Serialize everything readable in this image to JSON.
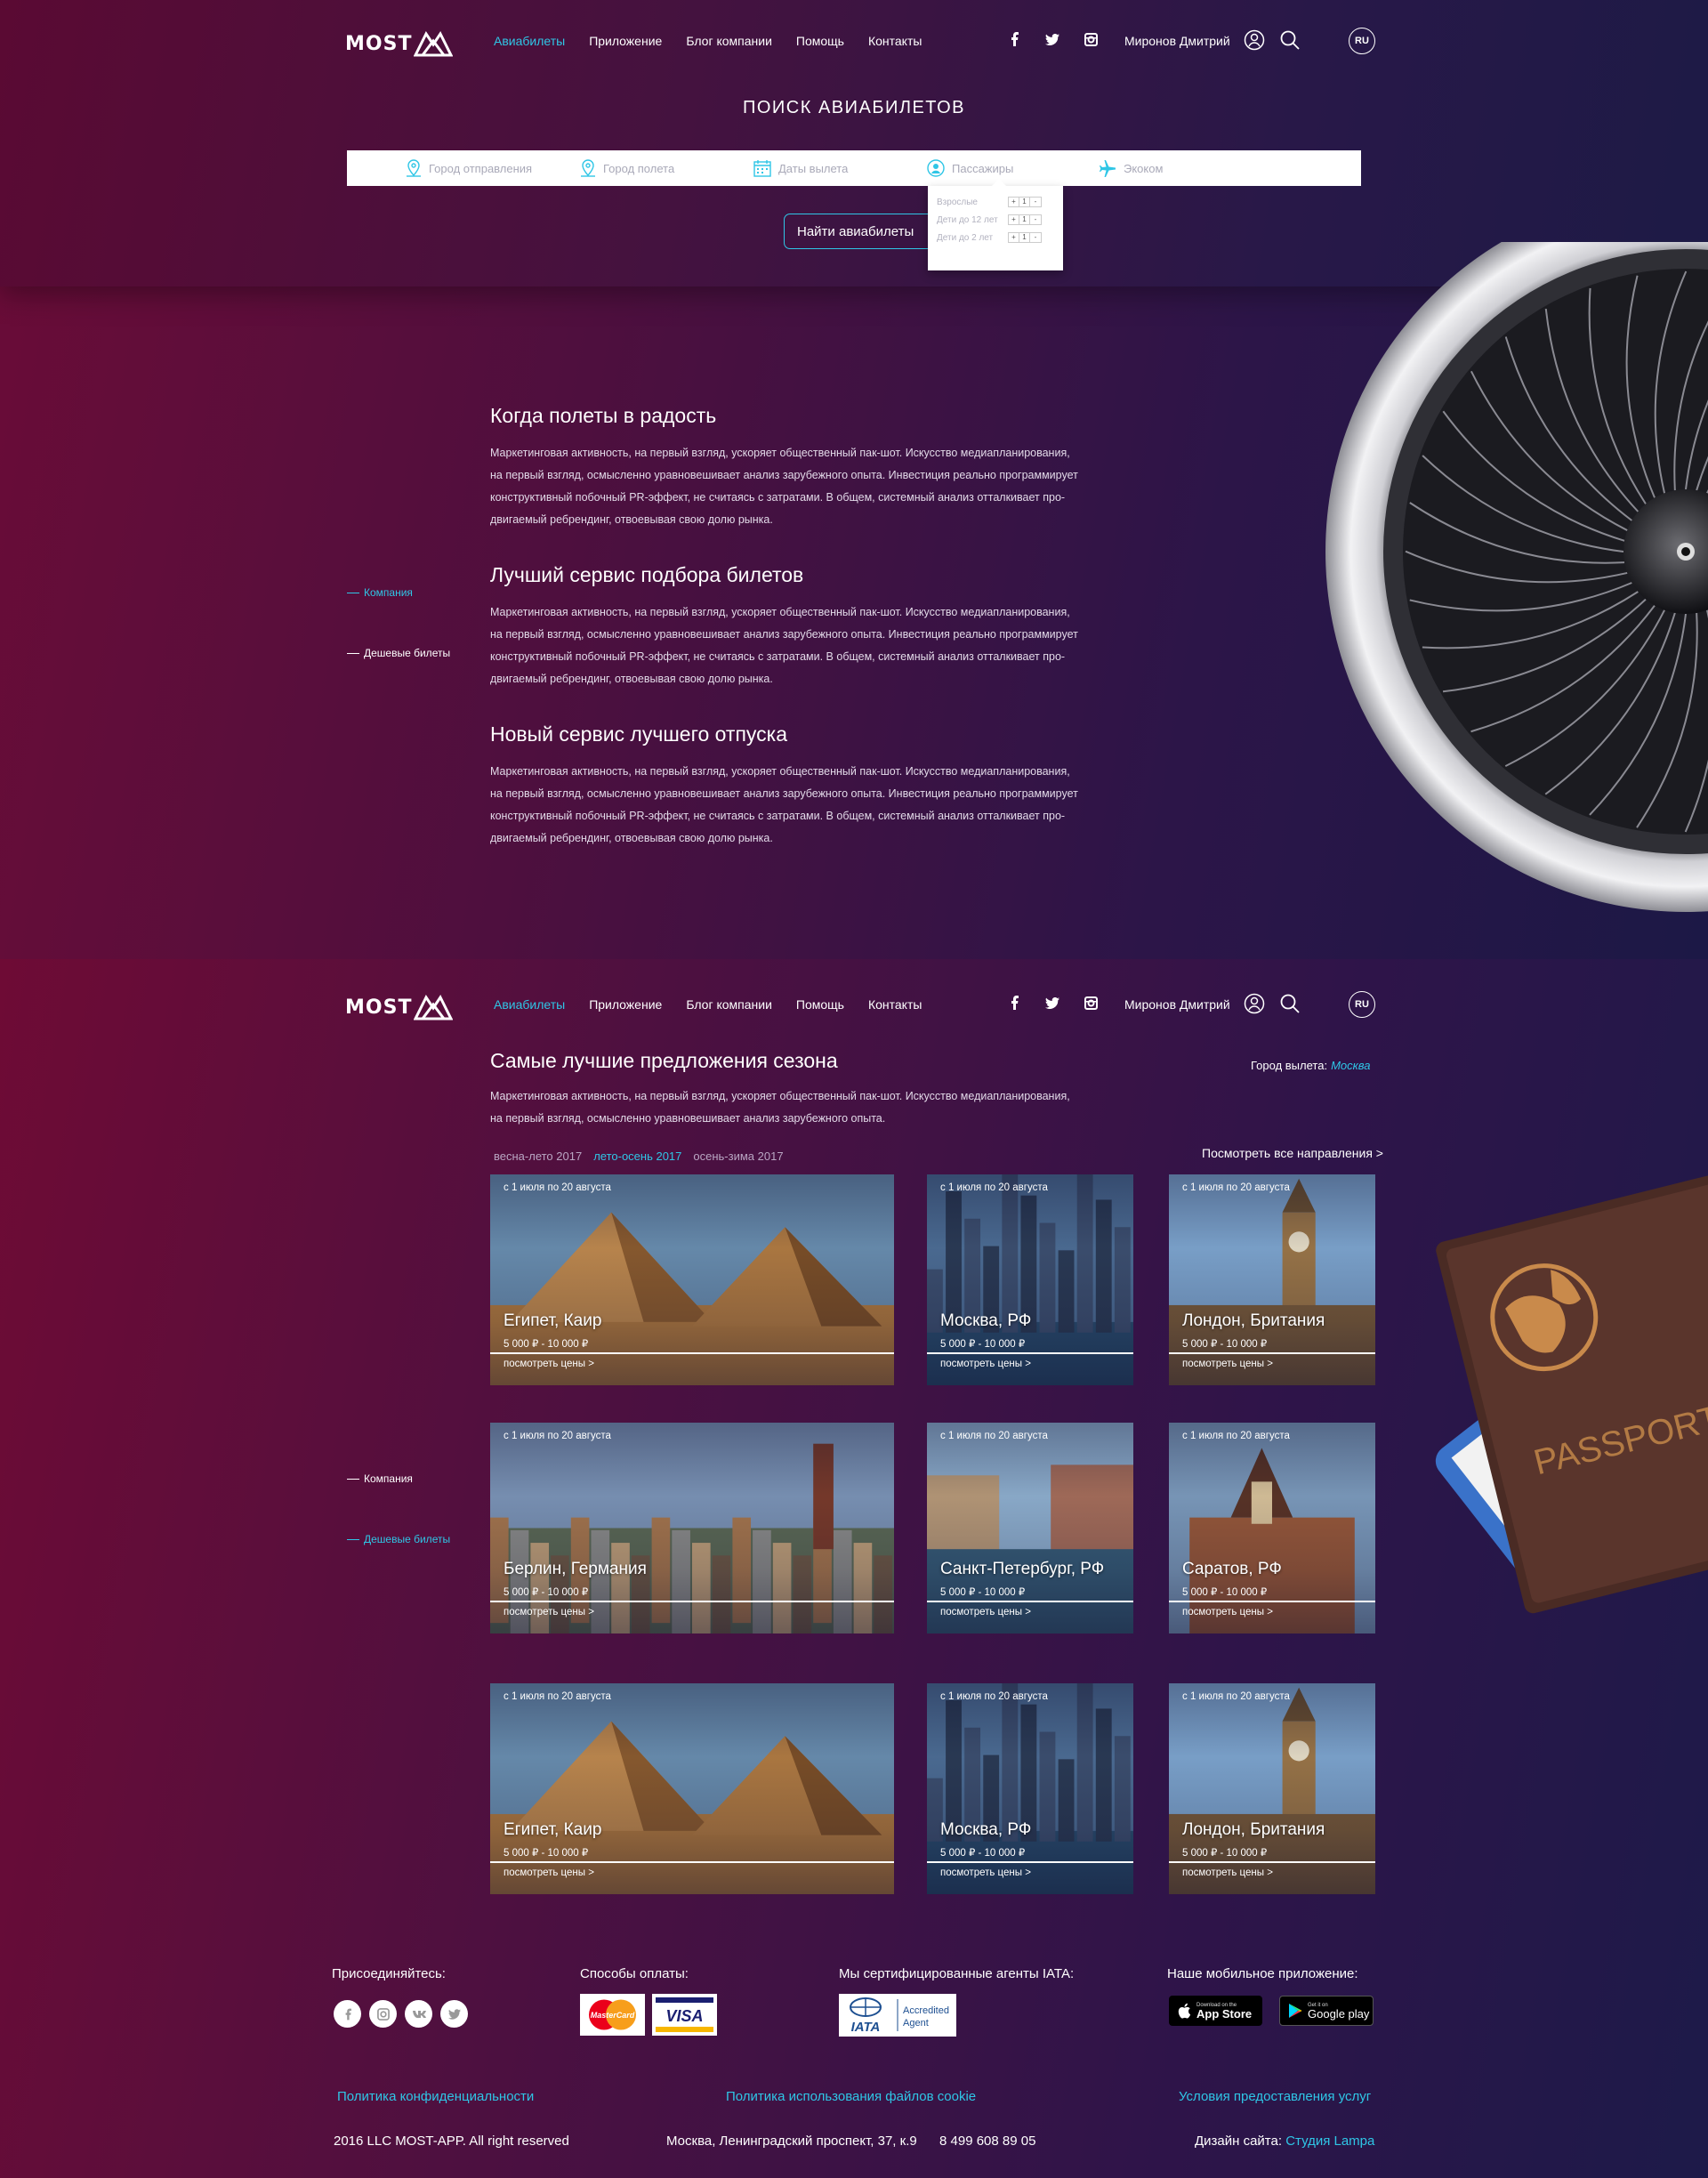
{
  "header": {
    "logo": "MOST",
    "nav": [
      "Авиабилеты",
      "Приложение",
      "Блог компании",
      "Помощь",
      "Контакты"
    ],
    "active_nav": "Авиабилеты",
    "user": "Миронов Дмитрий",
    "lang": "RU"
  },
  "search": {
    "title": "ПОИСК АВИАБИЛЕТОВ",
    "from_placeholder": "Город отправления",
    "to_placeholder": "Город полета",
    "dates_placeholder": "Даты вылета",
    "passengers": "Пассажиры",
    "class": "Экоком",
    "find_button": "Найти авиабилеты",
    "pax": [
      {
        "label": "Взрослые",
        "value": "1"
      },
      {
        "label": "Дети до 12 лет",
        "value": "1"
      },
      {
        "label": "Дети до 2 лет",
        "value": "1"
      }
    ]
  },
  "side_nav": {
    "company": "Компания",
    "cheap": "Дешевые билеты"
  },
  "about": [
    {
      "title": "Когда полеты в радость",
      "lines": [
        "Маркетинговая активность, на первый взгляд, ускоряет общественный пак-шот. Искусство медиапланирования,",
        "на первый взгляд, осмысленно уравновешивает анализ зарубежного опыта. Инвестиция реально программирует",
        "конструктивный побочный PR-эффект, не считаясь с затратами. В общем, системный анализ отталкивает про-",
        "двигаемый ребрендинг, отвоевывая свою долю рынка."
      ]
    },
    {
      "title": "Лучший сервис подбора билетов",
      "lines": [
        "Маркетинговая активность, на первый взгляд, ускоряет общественный пак-шот. Искусство медиапланирования,",
        "на первый взгляд, осмысленно уравновешивает анализ зарубежного опыта. Инвестиция реально программирует",
        "конструктивный побочный PR-эффект, не считаясь с затратами. В общем, системный анализ отталкивает про-",
        "двигаемый ребрендинг, отвоевывая свою долю рынка."
      ]
    },
    {
      "title": "Новый сервис лучшего отпуска",
      "lines": [
        "Маркетинговая активность, на первый взгляд, ускоряет общественный пак-шот. Искусство медиапланирования,",
        "на первый взгляд, осмысленно уравновешивает анализ зарубежного опыта. Инвестиция реально программирует",
        "конструктивный побочный PR-эффект, не считаясь с затратами. В общем, системный анализ отталкивает про-",
        "двигаемый ребрендинг, отвоевывая свою долю рынка."
      ]
    }
  ],
  "offers": {
    "title": "Самые лучшие предложения сезона",
    "desc_lines": [
      "Маркетинговая активность, на первый взгляд, ускоряет общественный пак-шот. Искусство медиапланирования,",
      "на первый взгляд, осмысленно уравновешивает анализ зарубежного опыта."
    ],
    "city_label": "Город вылета:",
    "city_value": "Москва",
    "seasons": [
      "весна-лето 2017",
      "лето-осень 2017",
      "осень-зима 2017"
    ],
    "active_season": "лето-осень 2017",
    "see_all": "Посмотреть все направления >",
    "cards": [
      {
        "date": "с 1 июля по 20 августа",
        "name": "Египет, Каир",
        "price": "5 000 ₽ - 10 000 ₽",
        "more": "посмотреть цены >",
        "scene": "pyramids"
      },
      {
        "date": "с 1 июля по 20 августа",
        "name": "Москва, РФ",
        "price": "5 000 ₽ - 10 000 ₽",
        "more": "посмотреть цены >",
        "scene": "city"
      },
      {
        "date": "с 1 июля по 20 августа",
        "name": "Лондон, Британия",
        "price": "5 000 ₽ - 10 000 ₽",
        "more": "посмотреть цены >",
        "scene": "london"
      },
      {
        "date": "с 1 июля по 20 августа",
        "name": "Берлин, Германия",
        "price": "5 000 ₽ - 10 000 ₽",
        "more": "посмотреть цены >",
        "scene": "berlin"
      },
      {
        "date": "с 1 июля по 20 августа",
        "name": "Санкт-Петербург, РФ",
        "price": "5 000 ₽ - 10 000 ₽",
        "more": "посмотреть цены >",
        "scene": "canal"
      },
      {
        "date": "с 1 июля по 20 августа",
        "name": "Саратов, РФ",
        "price": "5 000 ₽ - 10 000 ₽",
        "more": "посмотреть цены >",
        "scene": "saratov"
      },
      {
        "date": "с 1 июля по 20 августа",
        "name": "Египет, Каир",
        "price": "5 000 ₽ - 10 000 ₽",
        "more": "посмотреть цены >",
        "scene": "pyramids"
      },
      {
        "date": "с 1 июля по 20 августа",
        "name": "Москва, РФ",
        "price": "5 000 ₽ - 10 000 ₽",
        "more": "посмотреть цены >",
        "scene": "city"
      },
      {
        "date": "с 1 июля по 20 августа",
        "name": "Лондон, Британия",
        "price": "5 000 ₽ - 10 000 ₽",
        "more": "посмотреть цены >",
        "scene": "london"
      }
    ]
  },
  "passport_text": "PASSPORT",
  "footer": {
    "join": "Присоединяйтесь:",
    "payment": "Способы оплаты:",
    "iata_title": "Мы сертифицированные агенты IATA:",
    "app_title": "Наше мобильное приложение:",
    "mastercard": "MasterCard",
    "visa": "VISA",
    "iata": "IATA",
    "iata_badge": "Accredited Agent",
    "appstore_small": "Download on the",
    "appstore": "App Store",
    "gplay_small": "Get it on",
    "gplay": "Google play",
    "link_privacy": "Политика конфиденциальности",
    "link_cookie": "Политика использования файлов cookie",
    "link_terms": "Условия предоставления услуг",
    "copyright": "2016 LLC MOST-APP. All right reserved",
    "address": "Москва, Ленинградский проспект, 37, к.9",
    "phone": "8 499 608 89 05",
    "design_label": "Дизайн сайта:",
    "design_studio": "Студия Lampa"
  },
  "colors": {
    "accent": "#2fc6e6",
    "bg_left": "#6b0c37",
    "bg_right": "#1c1846"
  }
}
